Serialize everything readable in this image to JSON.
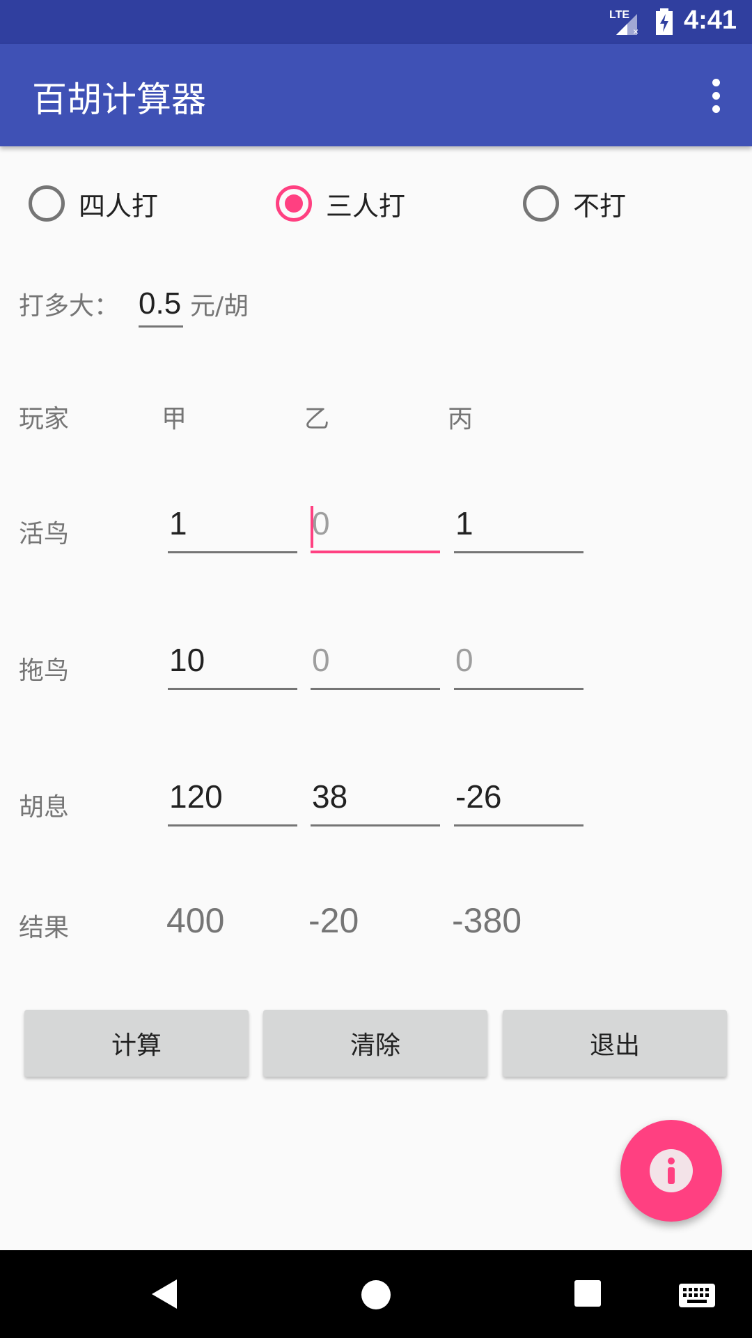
{
  "status_bar": {
    "time": "4:41",
    "network": "LTE"
  },
  "app_bar": {
    "title": "百胡计算器"
  },
  "mode_options": [
    {
      "label": "四人打",
      "checked": false
    },
    {
      "label": "三人打",
      "checked": true
    },
    {
      "label": "不打",
      "checked": false
    }
  ],
  "stake": {
    "label": "打多大：",
    "value": "0.5",
    "unit": "元/胡"
  },
  "table": {
    "header_label": "玩家",
    "players": [
      "甲",
      "乙",
      "丙"
    ],
    "rows": [
      {
        "label": "活鸟",
        "cells": [
          {
            "value": "1",
            "hint": false
          },
          {
            "value": "0",
            "hint": true
          },
          {
            "value": "1",
            "hint": false
          }
        ]
      },
      {
        "label": "拖鸟",
        "cells": [
          {
            "value": "10",
            "hint": false
          },
          {
            "value": "0",
            "hint": true
          },
          {
            "value": "0",
            "hint": true
          }
        ]
      },
      {
        "label": "胡息",
        "cells": [
          {
            "value": "120",
            "hint": false
          },
          {
            "value": "38",
            "hint": false
          },
          {
            "value": "-26",
            "hint": false
          }
        ]
      }
    ],
    "result_label": "结果",
    "results": [
      "400",
      "-20",
      "-380"
    ]
  },
  "buttons": {
    "calculate": "计算",
    "clear": "清除",
    "exit": "退出"
  },
  "icons": {
    "fab": "info-icon",
    "accent": "#ff4081",
    "primary": "#3f51b5",
    "primary_dark": "#303f9f"
  }
}
